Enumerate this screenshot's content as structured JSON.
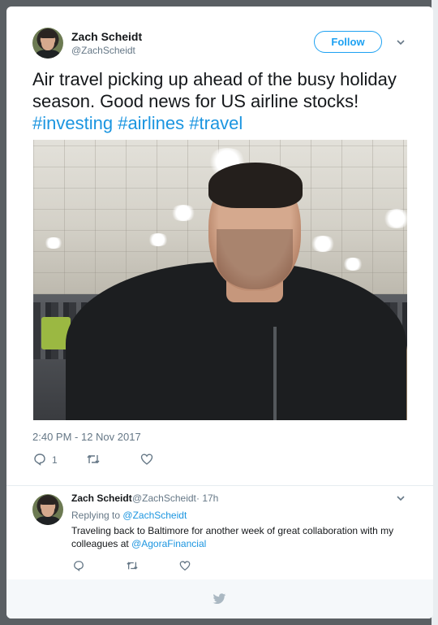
{
  "tweet": {
    "author": {
      "name": "Zach Scheidt",
      "handle": "@ZachScheidt"
    },
    "follow_label": "Follow",
    "text_plain": "Air travel picking up ahead of the busy holiday season. Good news for US airline stocks!",
    "hashtags": [
      "#investing",
      "#airlines",
      "#travel"
    ],
    "timestamp": "2:40 PM - 12 Nov 2017",
    "reply_count": "1"
  },
  "reply": {
    "author": {
      "name": "Zach Scheidt",
      "handle": "@ZachScheidt"
    },
    "time": "· 17h",
    "replying_to_label": "Replying to",
    "replying_to_handle": "@ZachScheidt",
    "text_plain": "Traveling back to Baltimore for another week of great collaboration with my colleagues at",
    "mention": "@AgoraFinancial"
  },
  "colors": {
    "link_blue": "#1b95e0",
    "follow_blue": "#1da1f2",
    "muted_gray": "#657786"
  },
  "icons": [
    "chevron-down-icon",
    "reply-icon",
    "retweet-icon",
    "like-icon",
    "twitter-bird-icon"
  ]
}
